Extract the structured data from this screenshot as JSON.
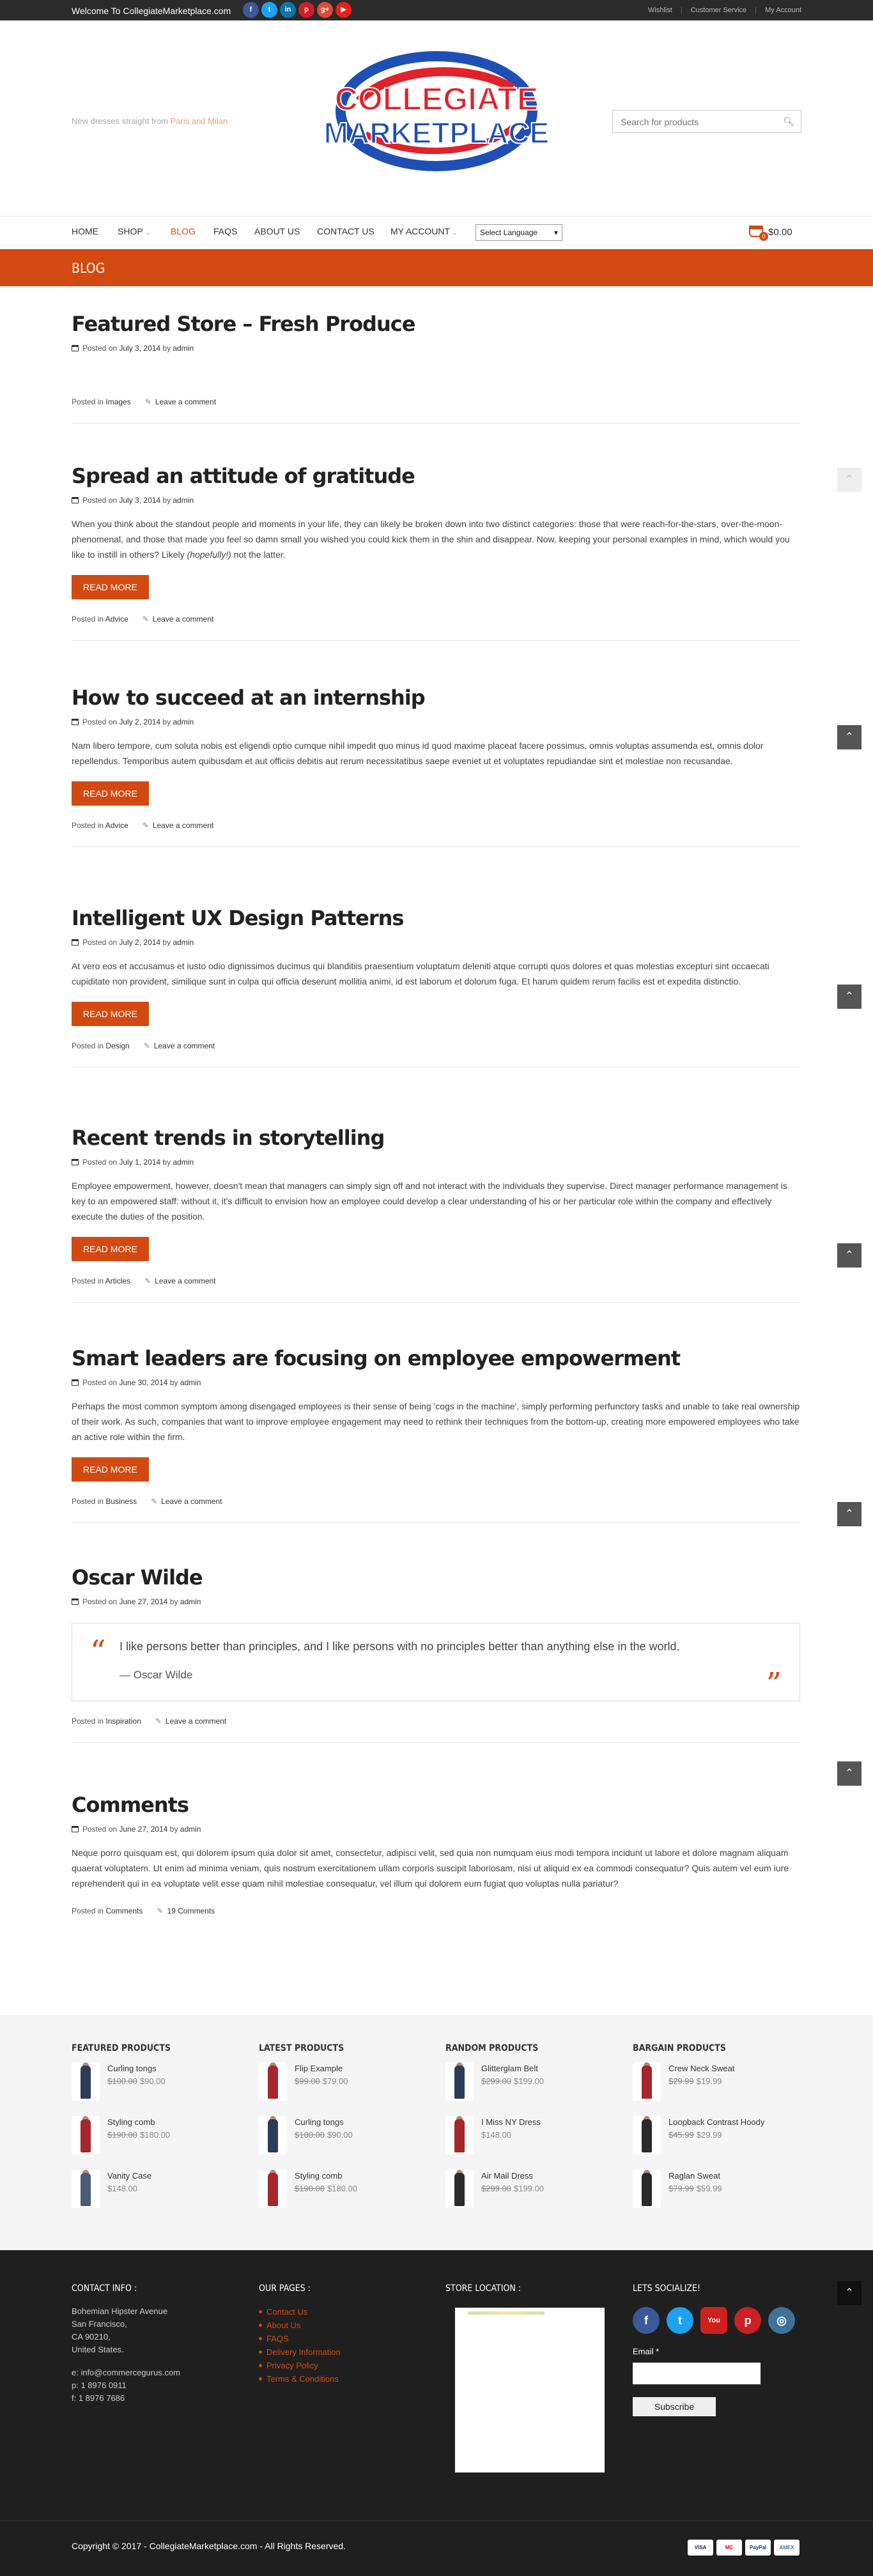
{
  "topbar": {
    "welcome": "Welcome To CollegiateMarketplace.com",
    "social": [
      {
        "icon": "facebook-icon",
        "glyph": "f",
        "color": "#3b5998"
      },
      {
        "icon": "twitter-icon",
        "glyph": "t",
        "color": "#1da1f2"
      },
      {
        "icon": "linkedin-icon",
        "glyph": "in",
        "color": "#0e76a8"
      },
      {
        "icon": "pinterest-icon",
        "glyph": "p",
        "color": "#cb2027"
      },
      {
        "icon": "google-plus-icon",
        "glyph": "g+",
        "color": "#dd4b39"
      },
      {
        "icon": "youtube-icon",
        "glyph": "▶",
        "color": "#e62117"
      }
    ],
    "links": [
      "Wishlist",
      "Customer Service",
      "My Account"
    ]
  },
  "header": {
    "tagline_prefix": "New dresses straight from ",
    "tagline_highlight": "Paris and Milan",
    "logo_line1": "COLLEGIATE",
    "logo_line2": "MARKETPLACE",
    "search_placeholder": "Search for products"
  },
  "nav": {
    "items": [
      "HOME",
      "SHOP",
      "BLOG",
      "FAQS",
      "ABOUT US",
      "CONTACT US",
      "MY ACCOUNT"
    ],
    "active": "BLOG",
    "language": "Select Language",
    "cart_count": "0",
    "cart_total": "$0.00"
  },
  "page_title": "BLOG",
  "labels": {
    "posted_on": "Posted on",
    "by": "by",
    "posted_in": "Posted in",
    "read_more": "READ MORE",
    "leave_comment": "Leave a comment"
  },
  "posts": [
    {
      "title": "Featured Store – Fresh Produce",
      "date": "July 3, 2014",
      "author": "admin",
      "category": "Images",
      "comments": "Leave a comment"
    },
    {
      "title": "Spread an attitude of gratitude",
      "date": "July 3, 2014",
      "author": "admin",
      "excerpt": "When you think about the standout people and moments in your life, they can likely be broken down into two distinct categories: those that were reach-for-the-stars, over-the-moon-phenomenal, and those that made you feel so damn small you wished you could kick them in the shin and disappear. Now, keeping your personal examples in mind, which would you like to instill in others? Likely ",
      "excerpt_em": "(hopefully!)",
      "excerpt_tail": " not the latter.",
      "category": "Advice",
      "comments": "Leave a comment"
    },
    {
      "title": "How to succeed at an internship",
      "date": "July 2, 2014",
      "author": "admin",
      "excerpt": "Nam libero tempore, cum soluta nobis est eligendi optio cumque nihil impedit quo minus id quod maxime placeat facere possimus, omnis voluptas assumenda est, omnis dolor repellendus. Temporibus autem quibusdam et aut officiis debitis aut rerum necessitatibus saepe eveniet ut et voluptates repudiandae sint et molestiae non recusandae.",
      "category": "Advice",
      "comments": "Leave a comment"
    },
    {
      "title": "Intelligent UX Design Patterns",
      "date": "July 2, 2014",
      "author": "admin",
      "excerpt": "At vero eos et accusamus et iusto odio dignissimos ducimus qui blanditiis praesentium voluptatum deleniti atque corrupti quos dolores et quas molestias excepturi sint occaecati cupiditate non provident, similique sunt in culpa qui officia deserunt mollitia animi, id est laborum et dolorum fuga. Et harum quidem rerum facilis est et expedita distinctio.",
      "category": "Design",
      "comments": "Leave a comment"
    },
    {
      "title": "Recent trends in storytelling",
      "date": "July 1, 2014",
      "author": "admin",
      "excerpt": "Employee empowerment, however, doesn't mean that managers can simply sign off and not interact with the individuals they supervise. Direct manager performance management is key to an empowered staff: without it, it's difficult to envision how an employee could develop a clear understanding of his or her particular role within the company and effectively execute the duties of the position.",
      "category": "Articles",
      "comments": "Leave a comment"
    },
    {
      "title": "Smart leaders are focusing on employee empowerment",
      "date": "June 30, 2014",
      "author": "admin",
      "excerpt": "Perhaps the most common symptom among disengaged employees is their sense of being 'cogs in the machine', simply performing perfunctory tasks and unable to take real ownership of their work. As such, companies that want to improve employee engagement may need to rethink their techniques from the bottom-up, creating more empowered employees who take an active role within the firm.",
      "category": "Business",
      "comments": "Leave a comment"
    },
    {
      "title": "Oscar Wilde",
      "date": "June 27, 2014",
      "author": "admin",
      "quote": "I like persons better than principles, and I like persons with no principles better than anything else in the world.",
      "quote_author": "— Oscar Wilde",
      "category": "Inspiration",
      "comments": "Leave a comment"
    },
    {
      "title": "Comments",
      "date": "June 27, 2014",
      "author": "admin",
      "excerpt": "Neque porro quisquam est, qui dolorem ipsum quia dolor sit amet, consectetur, adipisci velit, sed quia non numquam eius modi tempora incidunt ut labore et dolore magnam aliquam quaerat voluptatem. Ut enim ad minima veniam, quis nostrum exercitationem ullam corporis suscipit laboriosam, nisi ut aliquid ex ea commodi consequatur? Quis autem vel eum iure reprehenderit qui in ea voluptate velit esse quam nihil molestiae consequatur, vel illum qui dolorem eum fugiat quo voluptas nulla pariatur?",
      "category": "Comments",
      "comments": "19 Comments"
    }
  ],
  "product_columns": [
    {
      "heading": "FEATURED PRODUCTS",
      "items": [
        {
          "name": "Curling tongs",
          "old": "$100.00",
          "price": "$90.00",
          "thumb": "#2e3c5c"
        },
        {
          "name": "Styling comb",
          "old": "$190.00",
          "price": "$180.00",
          "thumb": "#a5262b"
        },
        {
          "name": "Vanity Case",
          "old": "",
          "price": "$148.00",
          "thumb": "#4a5b78"
        }
      ]
    },
    {
      "heading": "LATEST PRODUCTS",
      "items": [
        {
          "name": "Flip Example",
          "old": "$99.00",
          "price": "$79.00",
          "thumb": "#a5262b"
        },
        {
          "name": "Curling tongs",
          "old": "$100.00",
          "price": "$90.00",
          "thumb": "#2e3c5c"
        },
        {
          "name": "Styling comb",
          "old": "$190.00",
          "price": "$180.00",
          "thumb": "#a5262b"
        }
      ]
    },
    {
      "heading": "RANDOM PRODUCTS",
      "items": [
        {
          "name": "Glitterglam Belt",
          "old": "$299.00",
          "price": "$199.00",
          "thumb": "#2e3c5c"
        },
        {
          "name": "I Miss NY Dress",
          "old": "",
          "price": "$148.00",
          "thumb": "#a5262b"
        },
        {
          "name": "Air Mail Dress",
          "old": "$299.00",
          "price": "$199.00",
          "thumb": "#2a2a2a"
        }
      ]
    },
    {
      "heading": "BARGAIN PRODUCTS",
      "items": [
        {
          "name": "Crew Neck Sweat",
          "old": "$29.99",
          "price": "$19.99",
          "thumb": "#a5262b"
        },
        {
          "name": "Loopback Contrast Hoody",
          "old": "$45.99",
          "price": "$29.99",
          "thumb": "#2a2a2a"
        },
        {
          "name": "Raglan Sweat",
          "old": "$79.99",
          "price": "$59.99",
          "thumb": "#2a2a2a"
        }
      ]
    }
  ],
  "footer": {
    "contact_heading": "CONTACT INFO :",
    "address": [
      "Bohemian Hipster Avenue",
      "San Francisco,",
      "CA 90210,",
      "United States."
    ],
    "email": "e: info@commercegurus.com",
    "phone": "p: 1 8976 0911",
    "fax": "f: 1 8976 7686",
    "pages_heading": "OUR PAGES :",
    "pages": [
      "Contact Us",
      "About Us",
      "FAQS",
      "Delivery Information",
      "Privacy Policy",
      "Terms & Conditions"
    ],
    "store_heading": "STORE LOCATION :",
    "social_heading": "LETS SOCIALIZE!",
    "social": [
      {
        "icon": "facebook-icon",
        "glyph": "f",
        "color": "#3b5998"
      },
      {
        "icon": "twitter-icon",
        "glyph": "t",
        "color": "#1da1f2"
      },
      {
        "icon": "youtube-icon",
        "glyph": "You",
        "color": "#cd201f"
      },
      {
        "icon": "pinterest-icon",
        "glyph": "p",
        "color": "#cb2027"
      },
      {
        "icon": "instagram-icon",
        "glyph": "◎",
        "color": "#3f729b"
      }
    ],
    "email_label": "Email *",
    "subscribe": "Subscribe",
    "copyright": "Copyright © 2017 - CollegiateMarketplace.com - All Rights Reserved.",
    "payments": [
      {
        "label": "VISA",
        "color": "#1a1f71"
      },
      {
        "label": "MC",
        "color": "#eb001b"
      },
      {
        "label": "PayPal",
        "color": "#003087"
      },
      {
        "label": "AMEX",
        "color": "#2e77bc"
      }
    ]
  },
  "colors": {
    "accent": "#d24a11",
    "topbar": "#2b2b2b",
    "footer": "#1f1f1f"
  }
}
